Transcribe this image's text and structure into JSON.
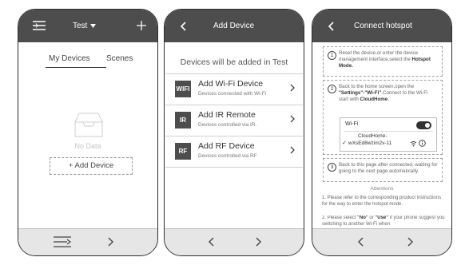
{
  "home": {
    "title": "Test",
    "tabs": [
      "My Devices",
      "Scenes"
    ],
    "empty_text": "No Data",
    "add_button": "+ Add Device"
  },
  "add_device": {
    "title": "Add Device",
    "subtitle": "Devices will be added in Test",
    "options": [
      {
        "badge": "WIFI",
        "title": "Add Wi-Fi Device",
        "subtitle": "Devices connected with Wi-Fi"
      },
      {
        "badge": "IR",
        "title": "Add IR Remote",
        "subtitle": "Devices controlled via IR."
      },
      {
        "badge": "RF",
        "title": "Add RF Device",
        "subtitle": "Devices controlled via RF"
      }
    ]
  },
  "hotspot": {
    "title": "Connect hotspot",
    "step1": {
      "num": "1",
      "text": "Reset the device,or enter the device management interface,select the",
      "bold": "Hotspot Mode."
    },
    "step2": {
      "num": "2",
      "text_a": "Back to the home screen,open the",
      "bold_a": "\"Settings\"-\"Wi-Fi\"",
      "text_b": ".Connect to the Wi-Fi start with",
      "bold_b": "CloudHome",
      "text_c": "."
    },
    "wifi_label": "Wi-Fi",
    "network_prefix": "CloudHome-",
    "network_name": "wXsEd8wzim2v-11",
    "step3": {
      "num": "3",
      "text": "Back to this page after connected, waiting for going to the next page automatically."
    },
    "attentions_title": "Attentions",
    "note1": "1. Please refer to the corresponding product instructions for the way to enter the hotspot mode.",
    "note2_a": "2. Please select",
    "note2_no": "\"No\"",
    "note2_b": "or",
    "note2_use": "\"Use\"",
    "note2_c": "if your phone suggest you switching to another Wi-Fi when"
  },
  "colors": {
    "header": "#4d4d4d",
    "footer": "#e6e6e6",
    "badge": "#4d4d4d"
  }
}
